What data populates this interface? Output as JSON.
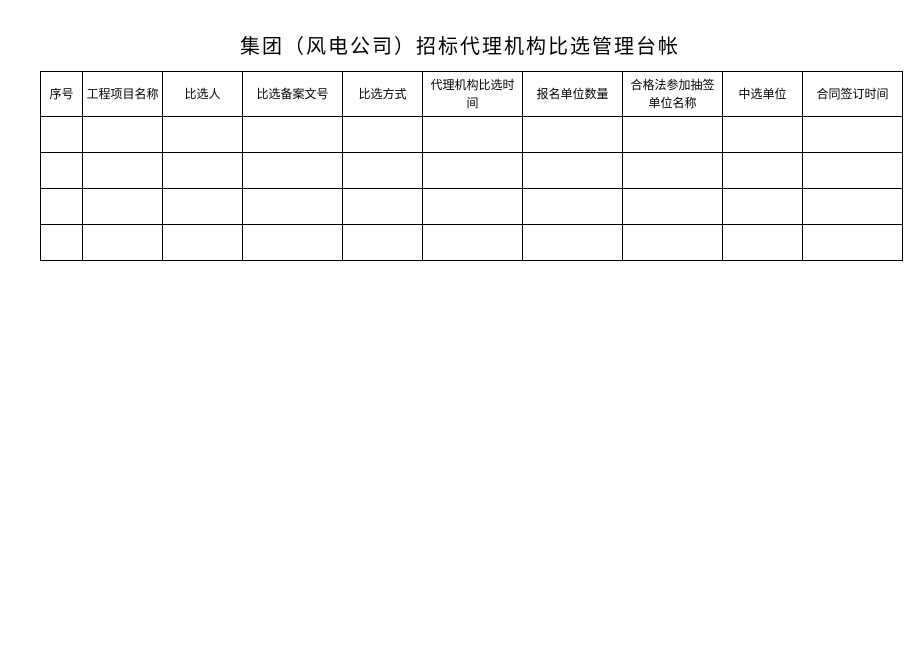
{
  "title": "集团（风电公司）招标代理机构比选管理台帐",
  "headers": [
    "序号",
    "工程项目名称",
    "比选人",
    "比选备案文号",
    "比选方式",
    "代理机构比选时间",
    "报名单位数量",
    "合格法参加抽签单位名称",
    "中选单位",
    "合同签订时间"
  ],
  "rows": [
    [
      "",
      "",
      "",
      "",
      "",
      "",
      "",
      "",
      "",
      ""
    ],
    [
      "",
      "",
      "",
      "",
      "",
      "",
      "",
      "",
      "",
      ""
    ],
    [
      "",
      "",
      "",
      "",
      "",
      "",
      "",
      "",
      "",
      ""
    ],
    [
      "",
      "",
      "",
      "",
      "",
      "",
      "",
      "",
      "",
      ""
    ]
  ]
}
